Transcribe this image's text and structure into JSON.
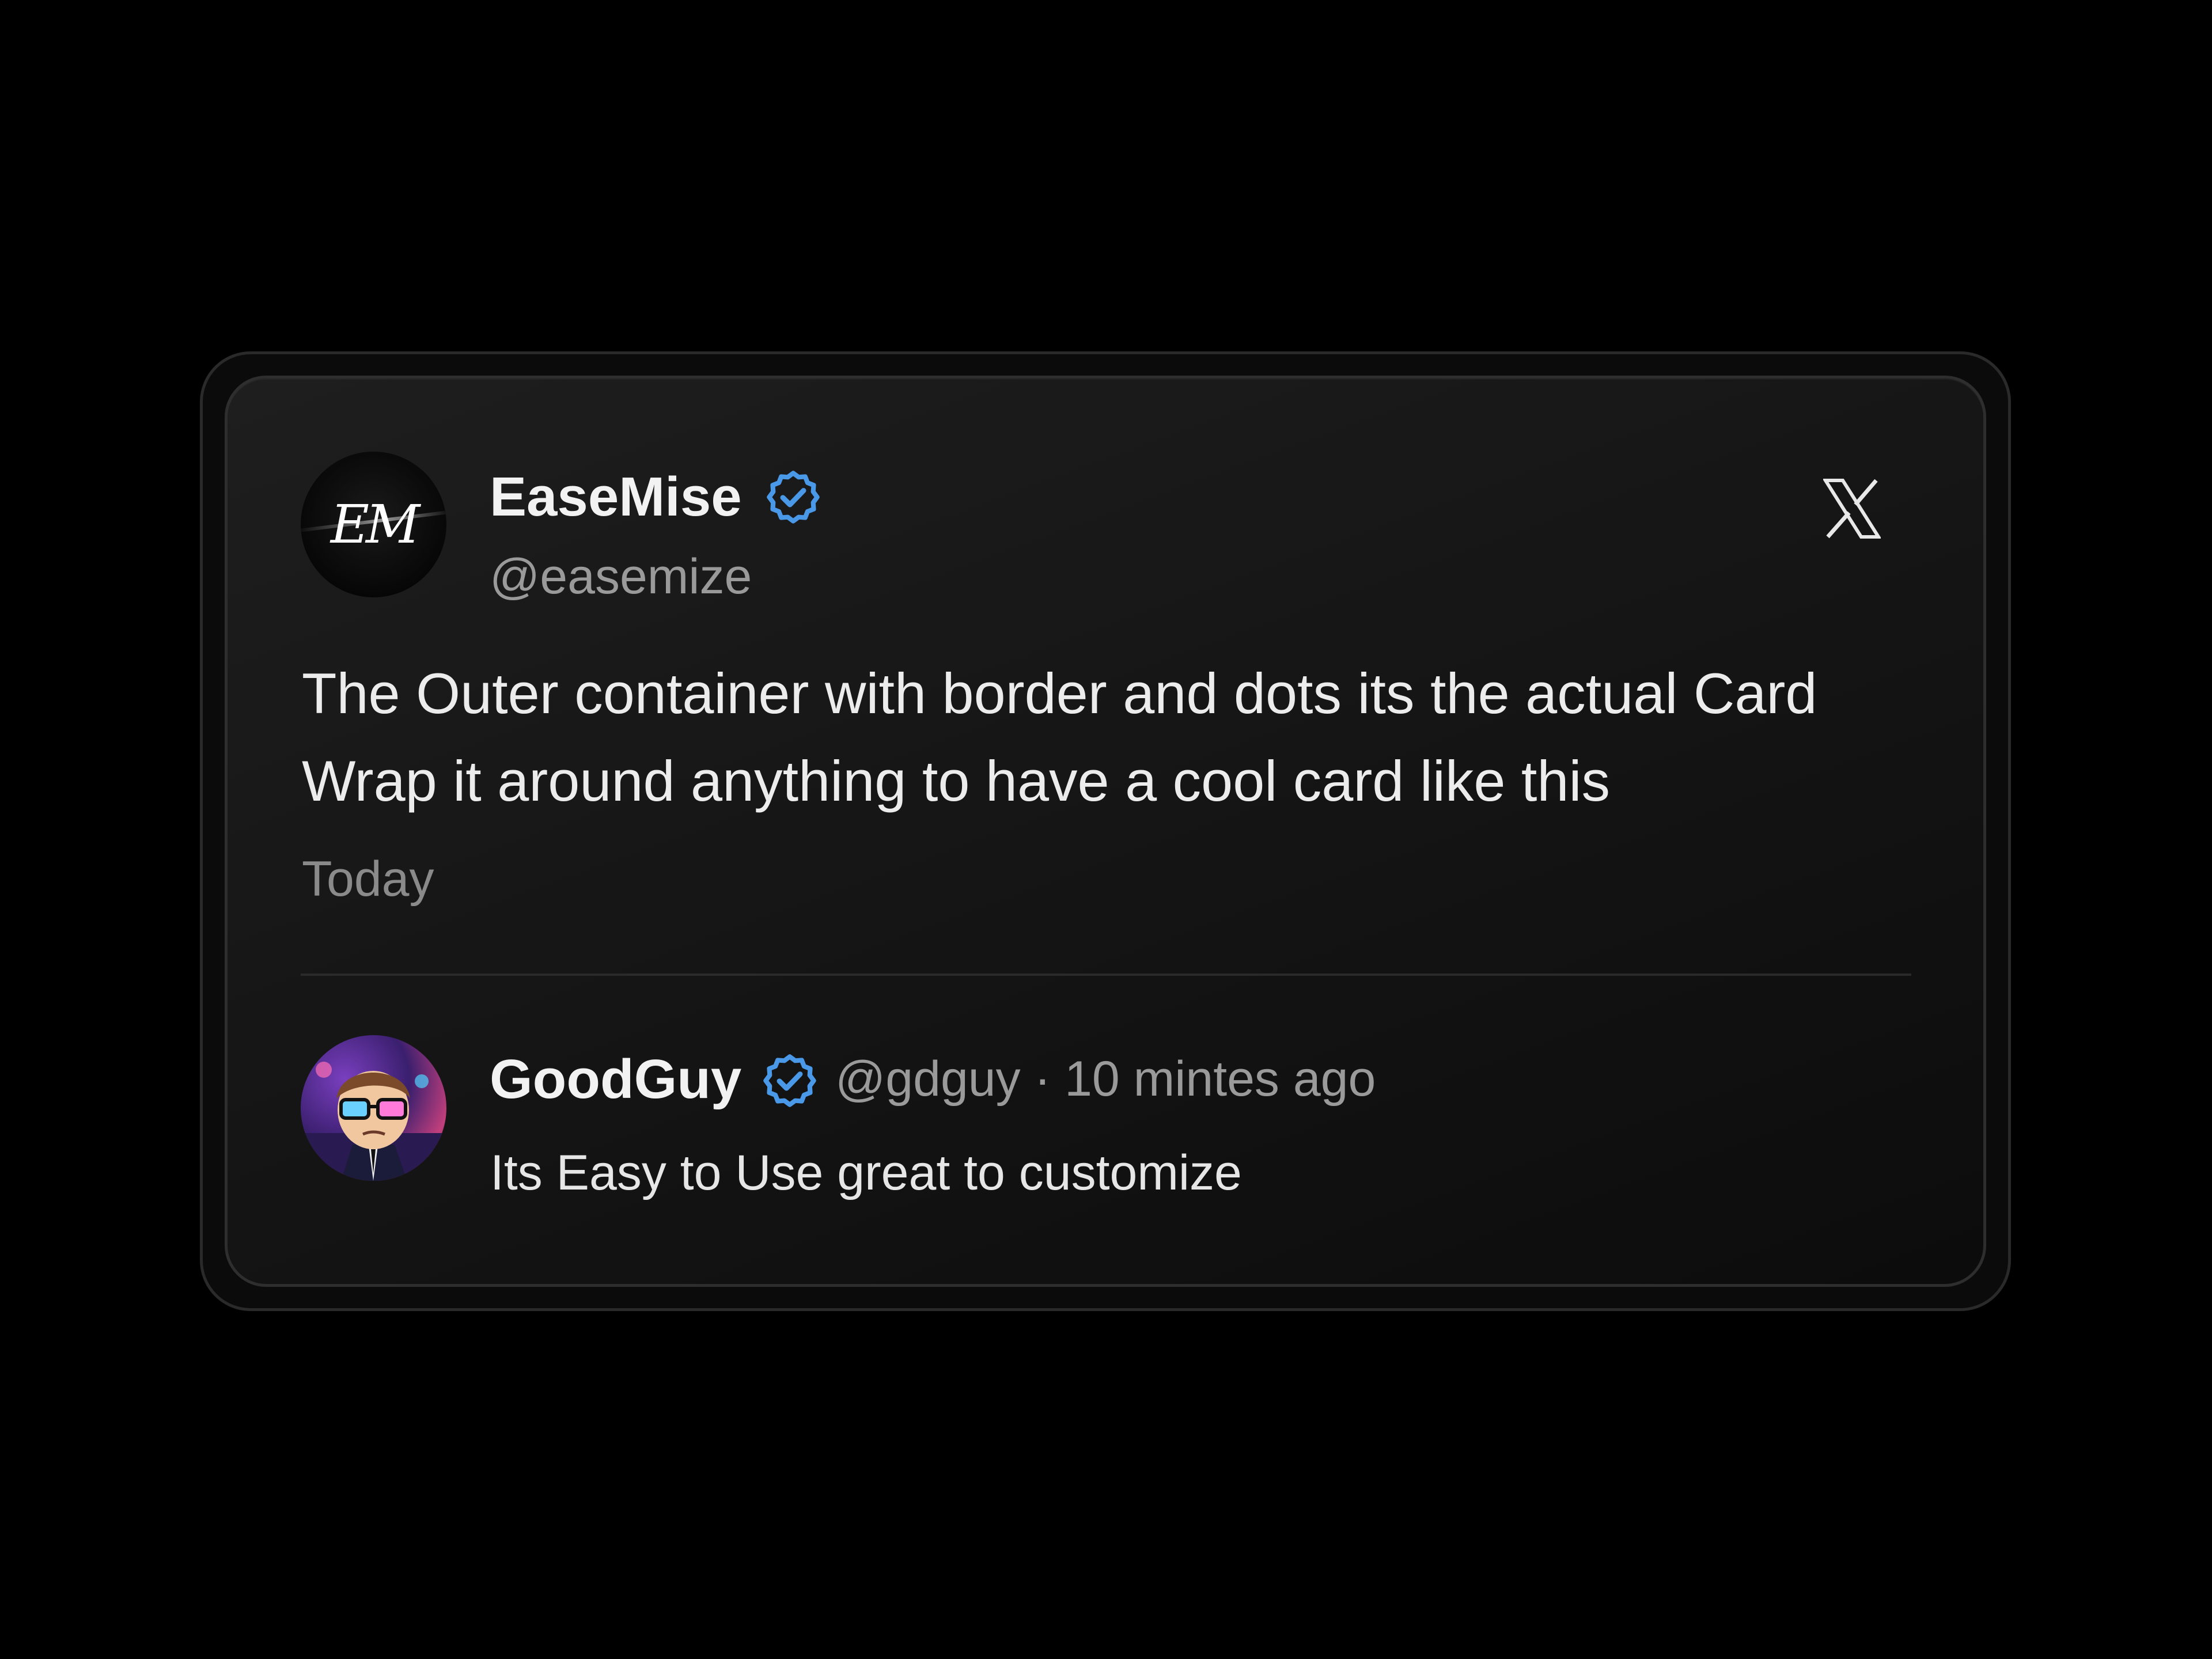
{
  "post": {
    "author_name": "EaseMise",
    "author_handle": "@easemize",
    "avatar_monogram": "EM",
    "verified_icon": "verified-badge-icon",
    "platform_icon": "x-logo-icon",
    "text_line1": "The Outer container with border and dots its the actual Card",
    "text_line2": "Wrap it around anything to have a cool card like this",
    "timestamp": "Today"
  },
  "reply": {
    "author_name": "GoodGuy",
    "author_handle": "@gdguy",
    "separator": "·",
    "time_ago": "10 mintes ago",
    "text": "Its Easy to Use great to customize",
    "verified_icon": "verified-badge-icon"
  },
  "colors": {
    "page_background": "#000000",
    "card_background": "#181818",
    "verified_blue": "#4a99e9",
    "primary_text": "#ececec",
    "secondary_text": "#9a9a9a"
  }
}
